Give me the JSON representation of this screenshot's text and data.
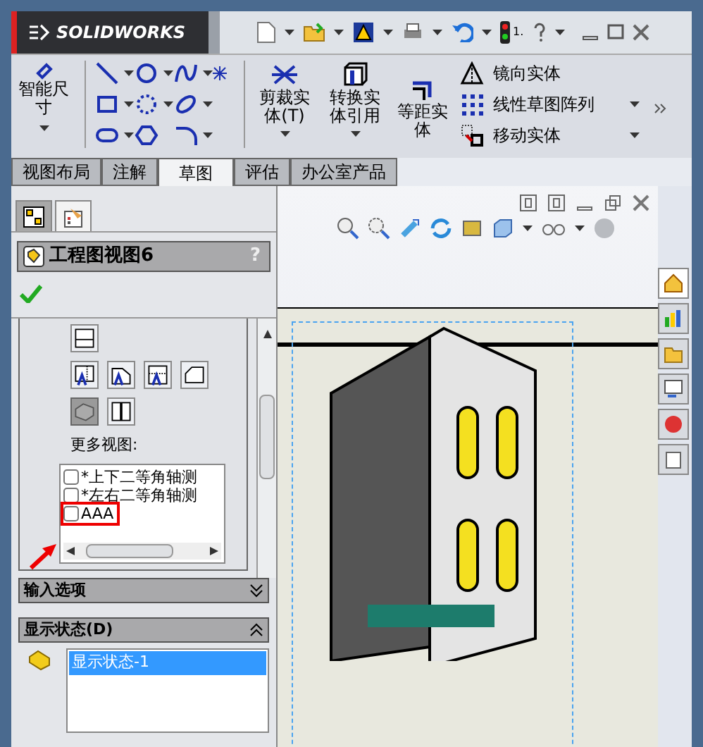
{
  "title_bar": {
    "logo": "SOLIDWORKS",
    "help_number": "1."
  },
  "ribbon": {
    "smart_dimension": "智能尺寸",
    "big_buttons": [
      {
        "label": "剪裁实体(T)"
      },
      {
        "label": "转换实体引用"
      },
      {
        "label": "等距实体"
      }
    ],
    "list_commands": [
      {
        "label": "镜向实体",
        "dropdown": false
      },
      {
        "label": "线性草图阵列",
        "dropdown": true
      },
      {
        "label": "移动实体",
        "dropdown": true
      }
    ]
  },
  "tabs": [
    {
      "label": "视图布局",
      "selected": false
    },
    {
      "label": "注解",
      "selected": false
    },
    {
      "label": "草图",
      "selected": true
    },
    {
      "label": "评估",
      "selected": false
    },
    {
      "label": "办公室产品",
      "selected": false
    }
  ],
  "panel": {
    "tabs": [
      {
        "selected": false
      },
      {
        "selected": true
      }
    ],
    "title": "工程图视图6",
    "help": "?",
    "view_buttons": [
      {
        "selected": false
      },
      {
        "selected": false
      },
      {
        "selected": false
      },
      {
        "selected": false
      },
      {
        "selected": false
      },
      {
        "selected": true
      },
      {
        "selected": false
      }
    ],
    "more_views_label": "更多视图:",
    "more_views": [
      {
        "label": "*上下二等角轴测",
        "checked": false,
        "highlighted": false
      },
      {
        "label": "*左右二等角轴测",
        "checked": false,
        "highlighted": false
      },
      {
        "label": "AAA",
        "checked": false,
        "highlighted": true
      }
    ],
    "sections": [
      {
        "title": "输入选项",
        "expanded": false
      },
      {
        "title": "显示状态(D)",
        "expanded": true,
        "items": [
          {
            "label": "显示状态-1",
            "selected": true
          }
        ]
      }
    ]
  }
}
